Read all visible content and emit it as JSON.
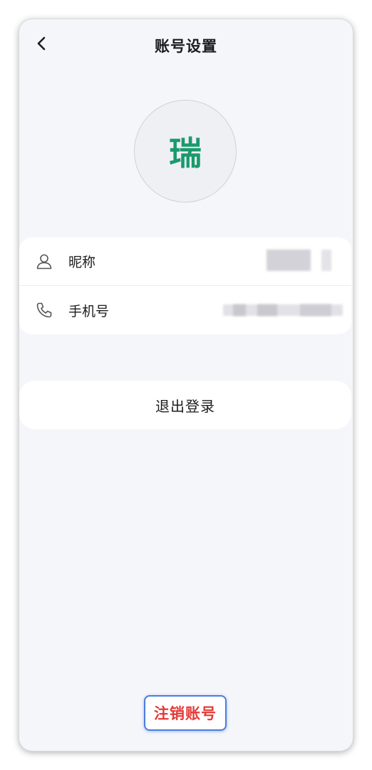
{
  "header": {
    "title": "账号设置",
    "back_icon": "chevron-left-icon"
  },
  "avatar": {
    "text": "瑞",
    "color": "#1a9a6c"
  },
  "account_info": {
    "rows": [
      {
        "label": "昵称",
        "icon": "user-icon",
        "value_redacted": true
      },
      {
        "label": "手机号",
        "icon": "phone-icon",
        "value_redacted": true
      }
    ]
  },
  "logout": {
    "label": "退出登录"
  },
  "deactivate": {
    "label": "注销账号",
    "color": "#e53935"
  }
}
